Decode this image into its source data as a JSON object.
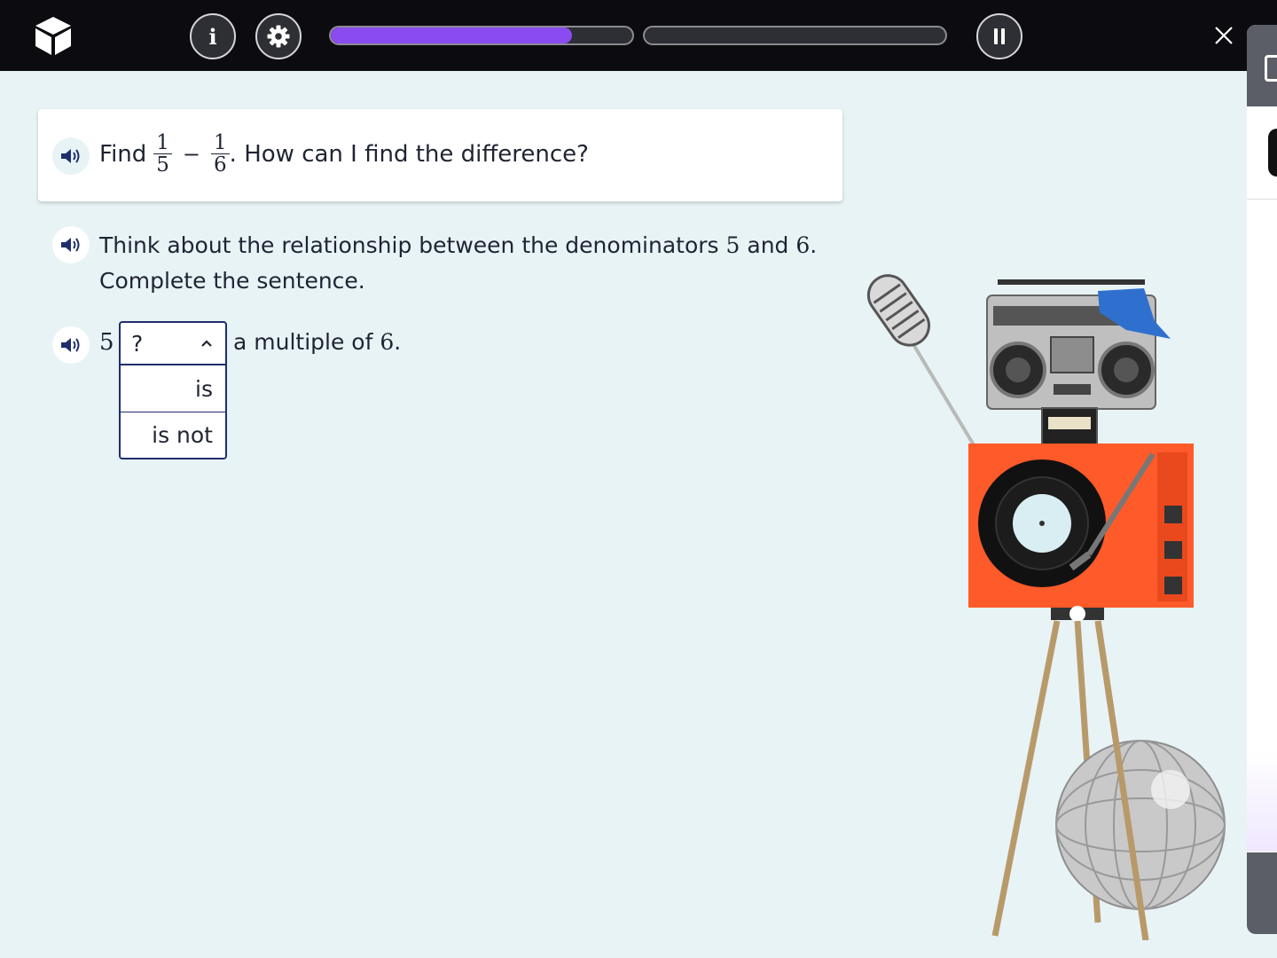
{
  "header": {
    "info_label": "i",
    "progress": [
      0.8,
      0.0
    ]
  },
  "question": {
    "prefix": "Find",
    "frac1": {
      "num": "1",
      "den": "5"
    },
    "operator": "−",
    "frac2": {
      "num": "1",
      "den": "6"
    },
    "suffix": ". How can I find the difference?"
  },
  "hint": {
    "line1_a": "Think about the relationship between the denominators ",
    "num_a": "5",
    "line1_b": " and ",
    "num_b": "6",
    "line1_c": ".",
    "line2": "Complete the sentence."
  },
  "sentence": {
    "lead_number": "5",
    "dropdown": {
      "selected": "?",
      "options": [
        "is",
        "is not"
      ]
    },
    "rest_text": "a multiple of ",
    "rest_number": "6",
    "rest_end": "."
  },
  "colors": {
    "accent": "#8a4bf0",
    "topbar": "#0c0c10",
    "background": "#e8f3f6",
    "dropdown_border": "#1f2e6b"
  },
  "icons": [
    "cube-logo-icon",
    "info-icon",
    "gear-icon",
    "pause-icon",
    "close-icon",
    "speaker-icon",
    "chevron-up-icon"
  ]
}
